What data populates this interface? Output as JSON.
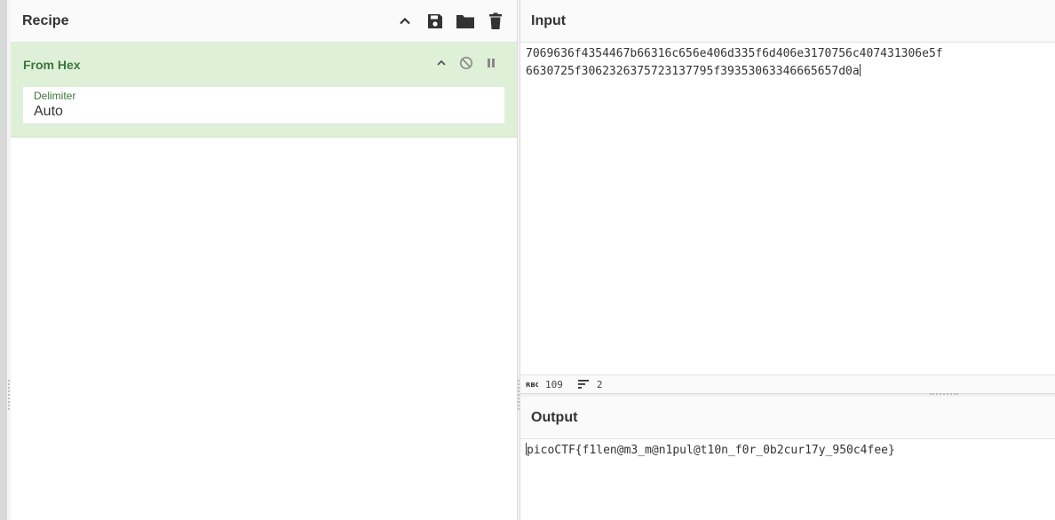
{
  "recipe": {
    "title": "Recipe",
    "operation": {
      "name": "From Hex",
      "delimiter_label": "Delimiter",
      "delimiter_value": "Auto"
    }
  },
  "input": {
    "title": "Input",
    "line1": "7069636f4354467b66316c656e406d335f6d406e3170756c407431306e5f",
    "line2": "6630725f3062326375723137795f39353063346665657d0a",
    "length": "109",
    "lines": "2"
  },
  "output": {
    "title": "Output",
    "text": "picoCTF{f1len@m3_m@n1pul@t10n_f0r_0b2cur17y_950c4fee}"
  },
  "icons": {
    "collapse": "chevron-up-icon",
    "save": "save-icon",
    "load": "folder-icon",
    "clear": "trash-icon",
    "disable": "disable-icon",
    "breakpoint": "pause-icon",
    "length": "abc-length-icon",
    "lines": "lines-icon"
  },
  "colors": {
    "operation_bg": "#dff0d8",
    "operation_text": "#3c763d"
  }
}
